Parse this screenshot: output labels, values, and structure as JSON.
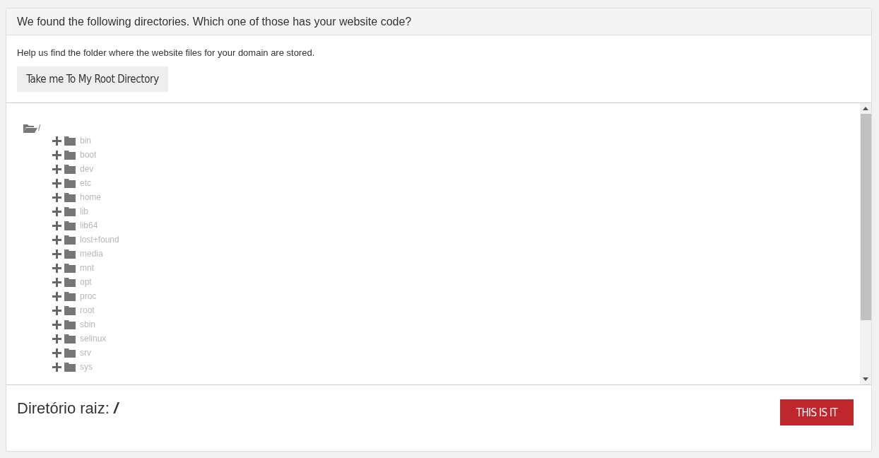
{
  "header": {
    "title": "We found the following directories. Which one of those has your website code?"
  },
  "instructions": "Help us find the folder where the website files for your domain are stored.",
  "root_button": "Take me To My Root Directory",
  "tree": {
    "label": "/",
    "expanded": true,
    "children": [
      {
        "label": "bin",
        "expanded": false
      },
      {
        "label": "boot",
        "expanded": false
      },
      {
        "label": "dev",
        "expanded": false
      },
      {
        "label": "etc",
        "expanded": false
      },
      {
        "label": "home",
        "expanded": false
      },
      {
        "label": "lib",
        "expanded": false
      },
      {
        "label": "lib64",
        "expanded": false
      },
      {
        "label": "lost+found",
        "expanded": false
      },
      {
        "label": "media",
        "expanded": false
      },
      {
        "label": "mnt",
        "expanded": false
      },
      {
        "label": "opt",
        "expanded": false
      },
      {
        "label": "proc",
        "expanded": false
      },
      {
        "label": "root",
        "expanded": false
      },
      {
        "label": "sbin",
        "expanded": false
      },
      {
        "label": "selinux",
        "expanded": false
      },
      {
        "label": "srv",
        "expanded": false
      },
      {
        "label": "sys",
        "expanded": false
      }
    ]
  },
  "footer": {
    "label": "Diretório raiz:",
    "value": "/",
    "confirm_button": "THIS IS IT"
  }
}
